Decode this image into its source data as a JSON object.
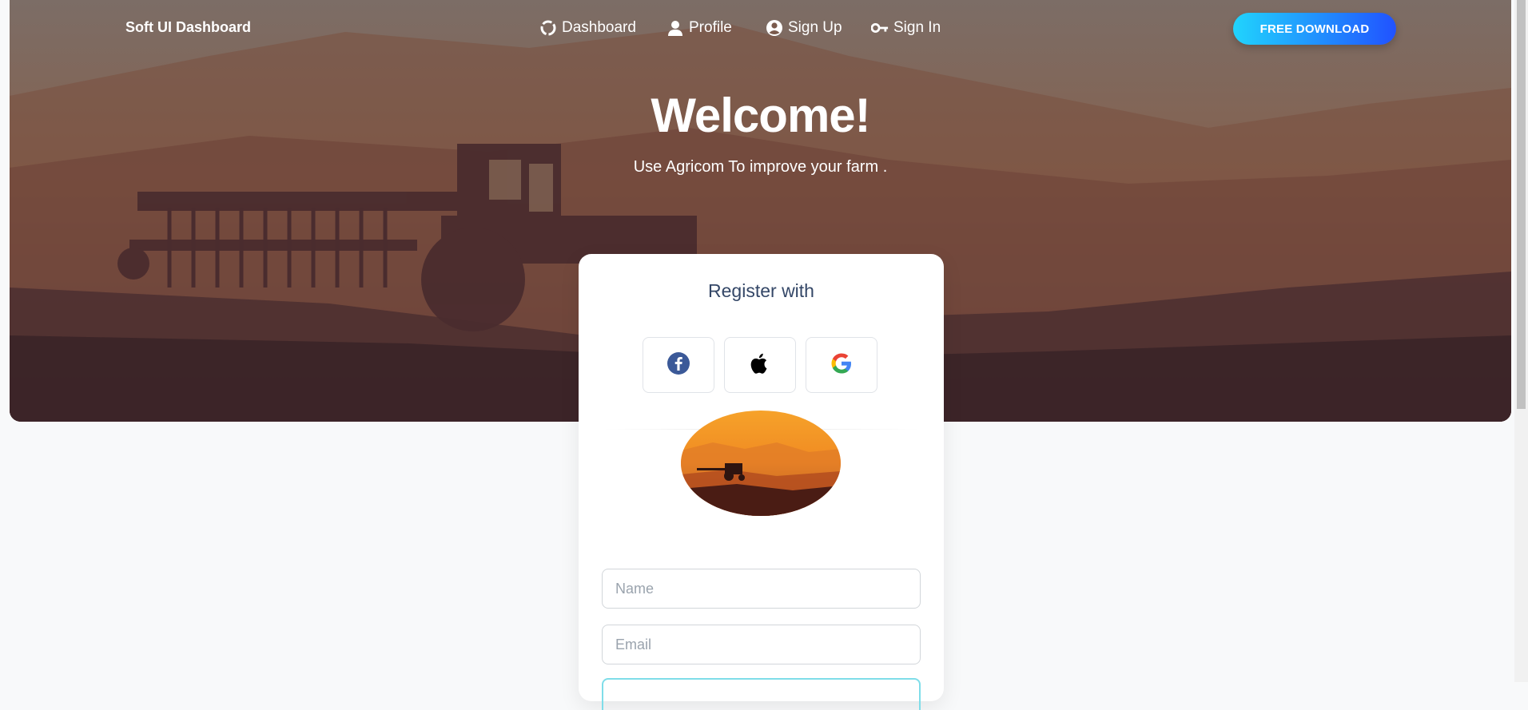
{
  "brand": "Soft UI Dashboard",
  "nav": {
    "items": [
      {
        "label": "Dashboard",
        "icon": "dashboard-icon"
      },
      {
        "label": "Profile",
        "icon": "user-icon"
      },
      {
        "label": "Sign Up",
        "icon": "account-circle-icon"
      },
      {
        "label": "Sign In",
        "icon": "key-icon"
      }
    ],
    "cta_label": "FREE DOWNLOAD"
  },
  "hero": {
    "title": "Welcome!",
    "subtitle": "Use Agricom To improve your farm ."
  },
  "register": {
    "title": "Register with",
    "social": [
      "facebook-icon",
      "apple-icon",
      "google-icon"
    ],
    "name_placeholder": "Name",
    "email_placeholder": "Email"
  },
  "colors": {
    "cta_gradient_start": "#21d4fd",
    "cta_gradient_end": "#2152ff",
    "title_text": "#344767",
    "facebook": "#3b5998"
  }
}
